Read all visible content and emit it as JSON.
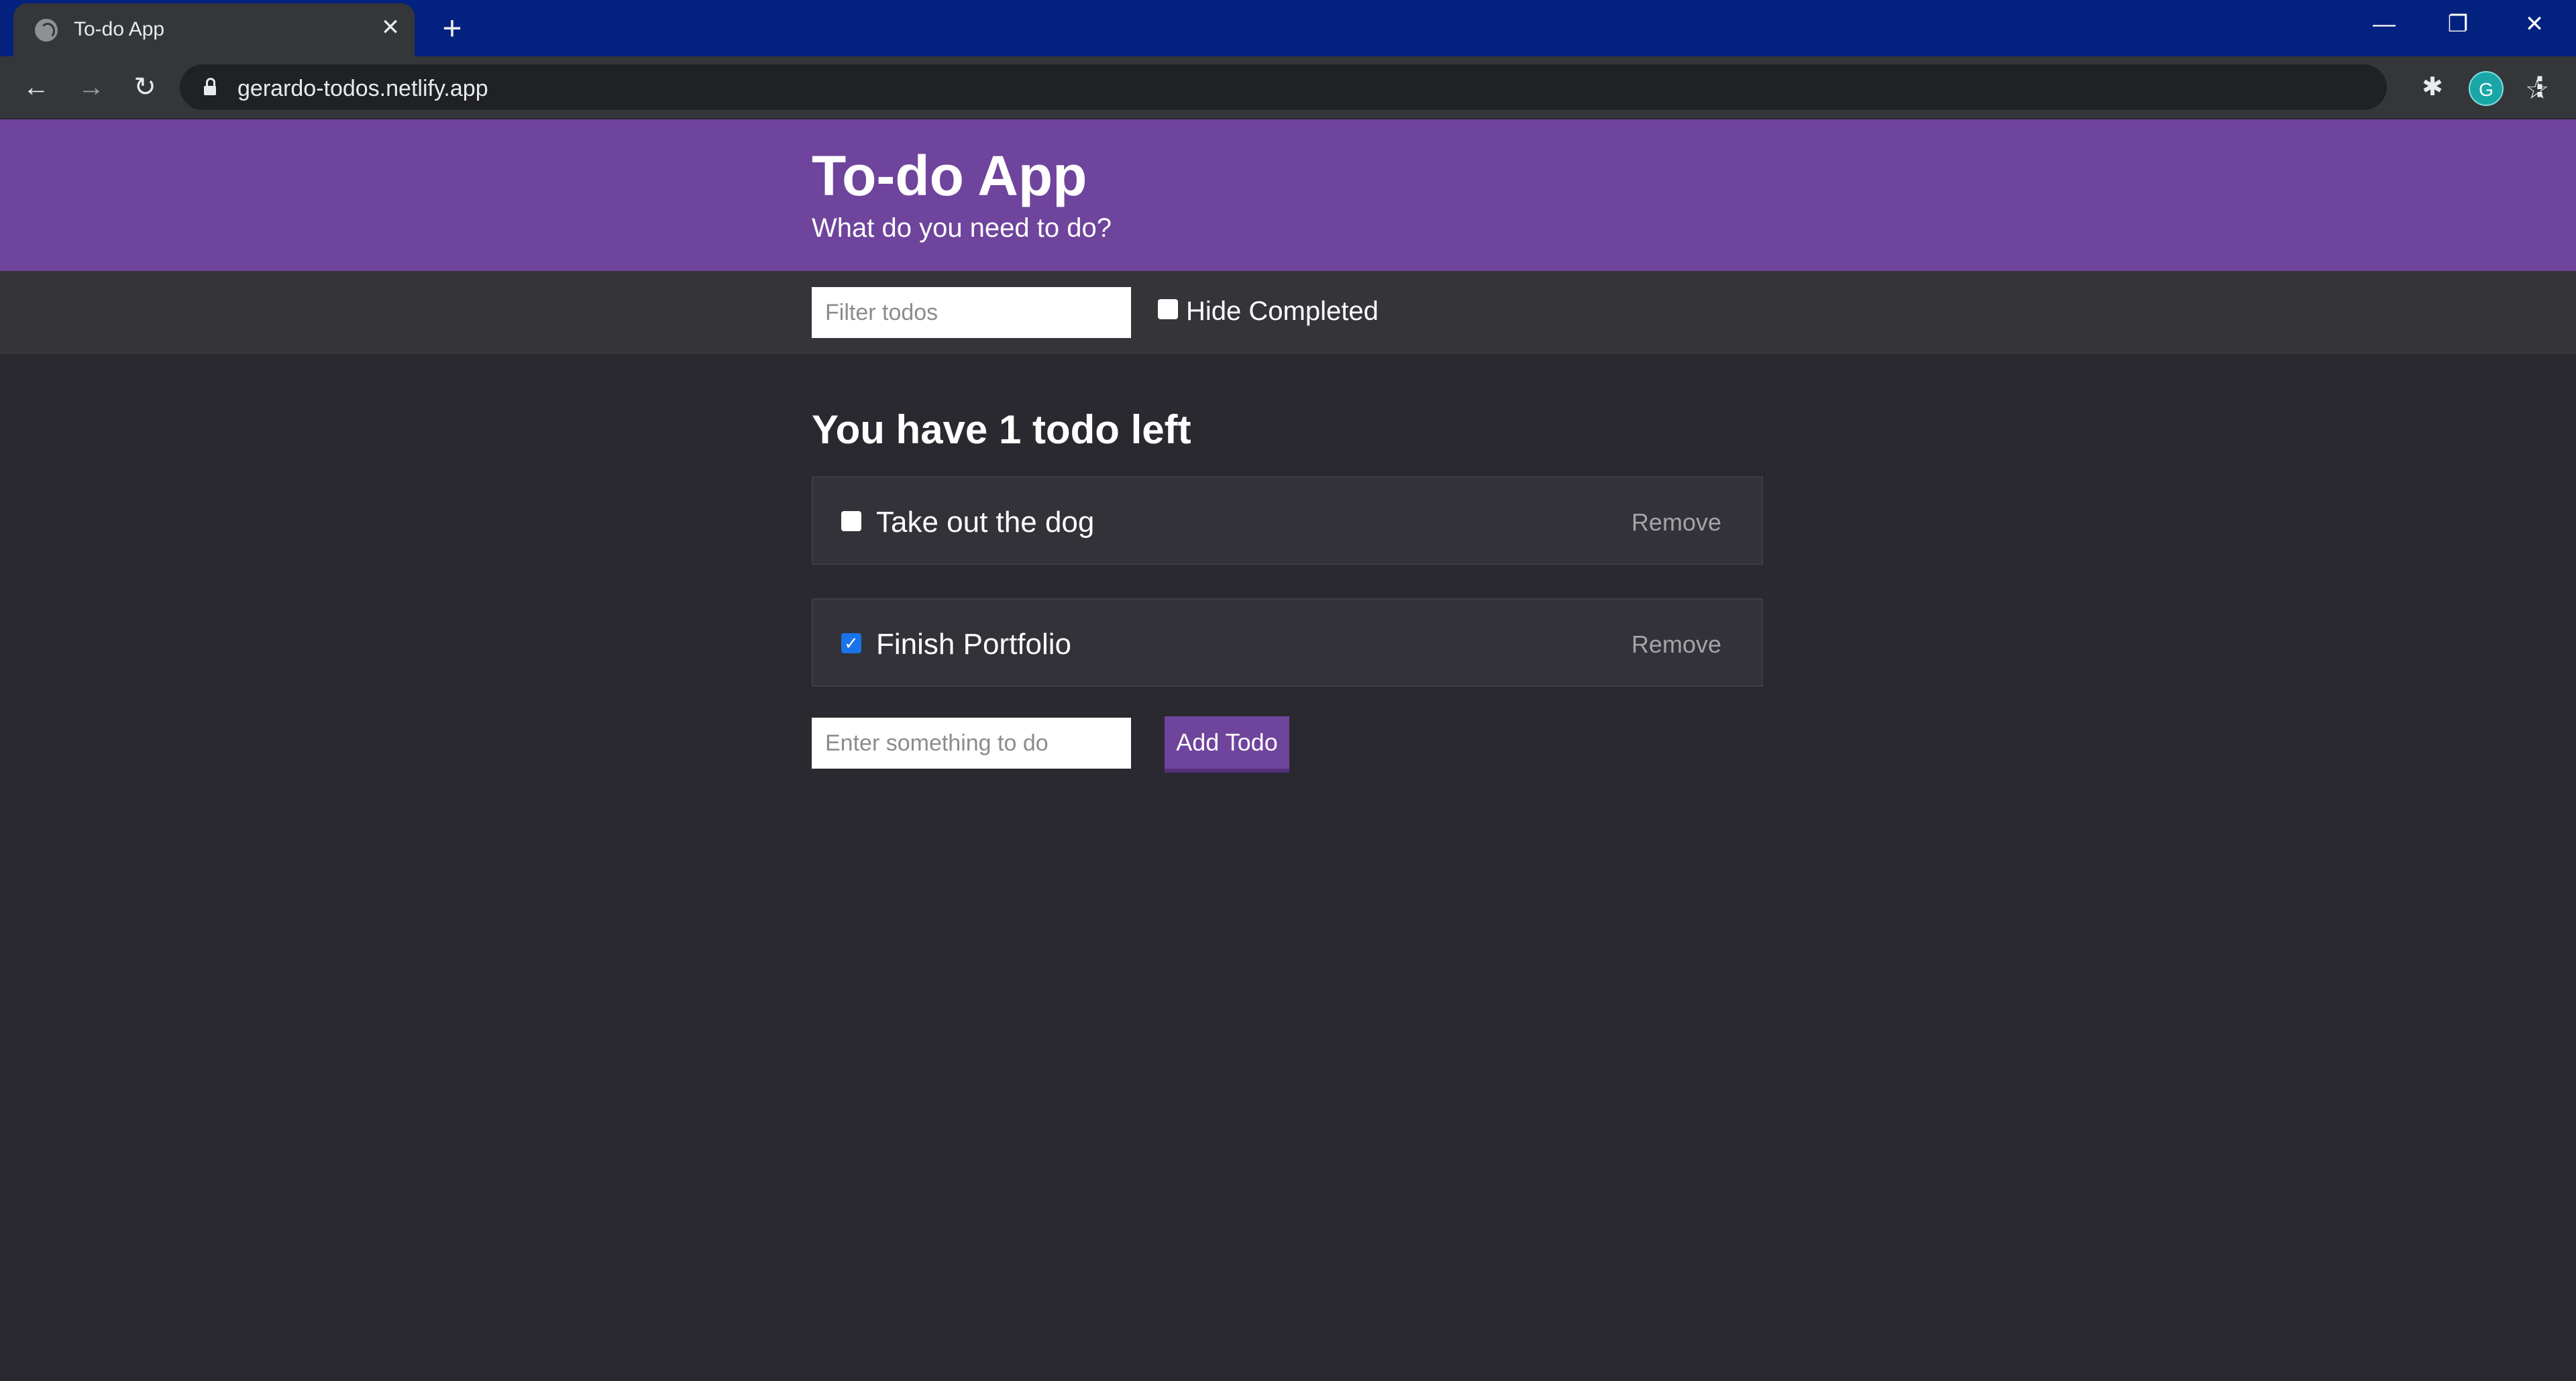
{
  "browser": {
    "tab_title": "To-do App",
    "tab_close": "✕",
    "new_tab": "+",
    "url": "gerardo-todos.netlify.app",
    "avatar_initial": "G",
    "icons": {
      "favicon": "globe-icon",
      "back": "back-arrow-icon",
      "forward": "forward-arrow-icon",
      "reload": "reload-icon",
      "lock": "lock-icon",
      "bookmark": "star-icon",
      "extensions": "puzzle-icon",
      "menu": "kebab-menu-icon"
    },
    "colors": {
      "tabbar": "#03217f",
      "toolbar": "#35363a",
      "omnibox": "#202124"
    }
  },
  "header": {
    "title": "To-do App",
    "subtitle": "What do you need to do?"
  },
  "filters": {
    "search_placeholder": "Filter todos",
    "search_value": "",
    "hide_completed_label": "Hide Completed",
    "hide_completed_checked": false
  },
  "summary": "You have 1 todo left",
  "todos": [
    {
      "text": "Take out the dog",
      "completed": false,
      "remove_label": "Remove"
    },
    {
      "text": "Finish Portfolio",
      "completed": true,
      "remove_label": "Remove"
    }
  ],
  "add_form": {
    "placeholder": "Enter something to do",
    "value": "",
    "button_label": "Add Todo"
  },
  "colors": {
    "accent": "#6f449c",
    "background": "#2a2930",
    "actions_bar": "#353439",
    "checkbox_checked": "#1a73e8"
  }
}
